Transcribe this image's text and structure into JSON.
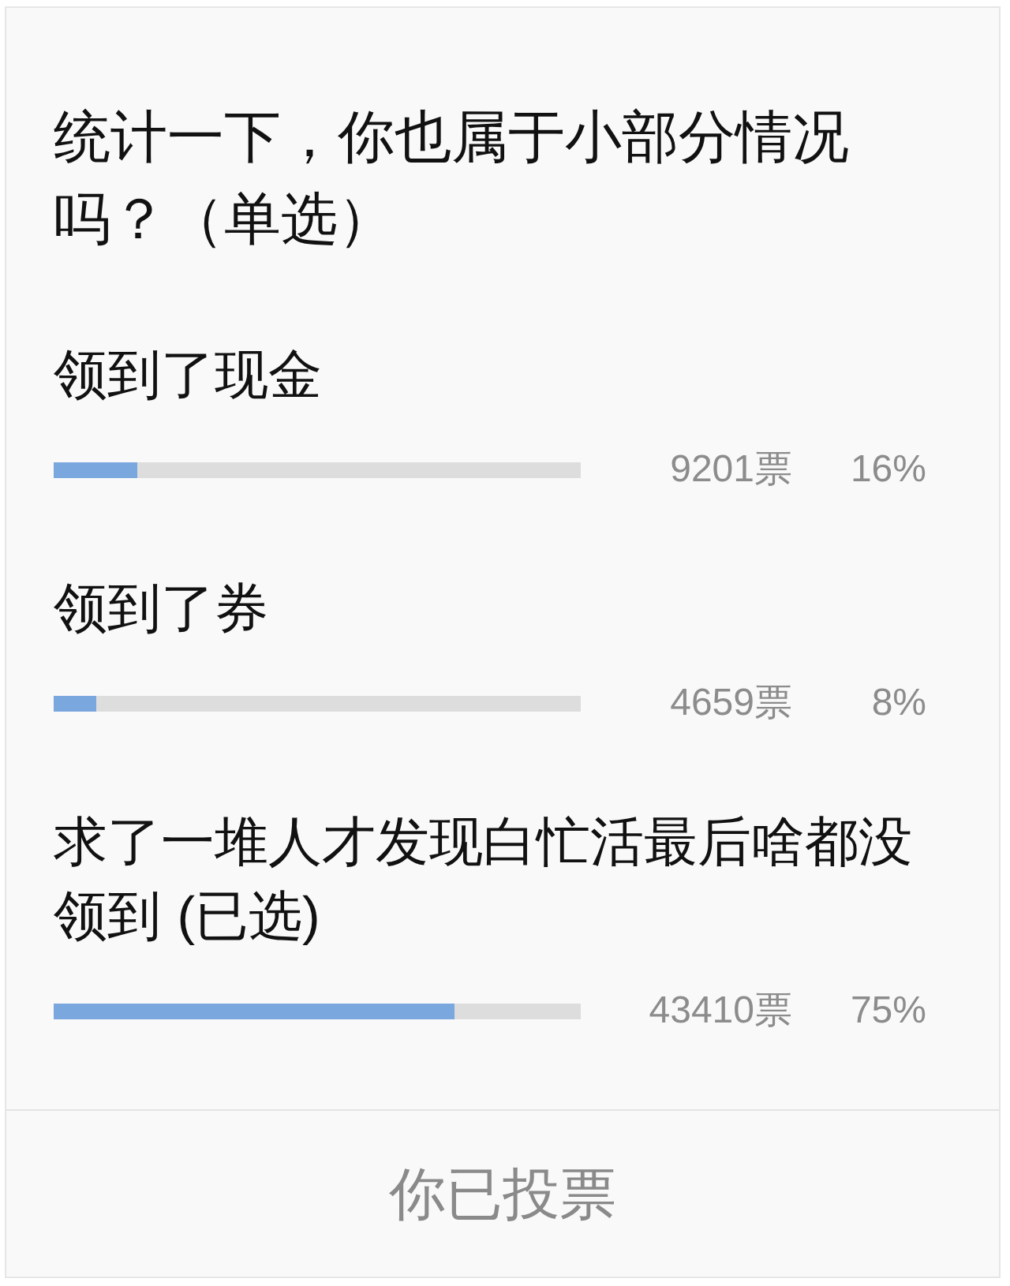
{
  "poll": {
    "question": "统计一下，你也属于小部分情况吗？（单选）",
    "selected_suffix": "(已选)",
    "options": [
      {
        "label": "领到了现金",
        "selected": false,
        "level": 0.16,
        "votes": "9201票",
        "percent": "16%"
      },
      {
        "label": "领到了券",
        "selected": false,
        "level": 0.08,
        "votes": "4659票",
        "percent": "8%"
      },
      {
        "label": "求了一堆人才发现白忙活最后啥都没领到",
        "selected": true,
        "level": 0.76,
        "votes": "43410票",
        "percent": "75%"
      }
    ]
  },
  "footer_button": {
    "label": "你已投票",
    "disabled": true
  }
}
